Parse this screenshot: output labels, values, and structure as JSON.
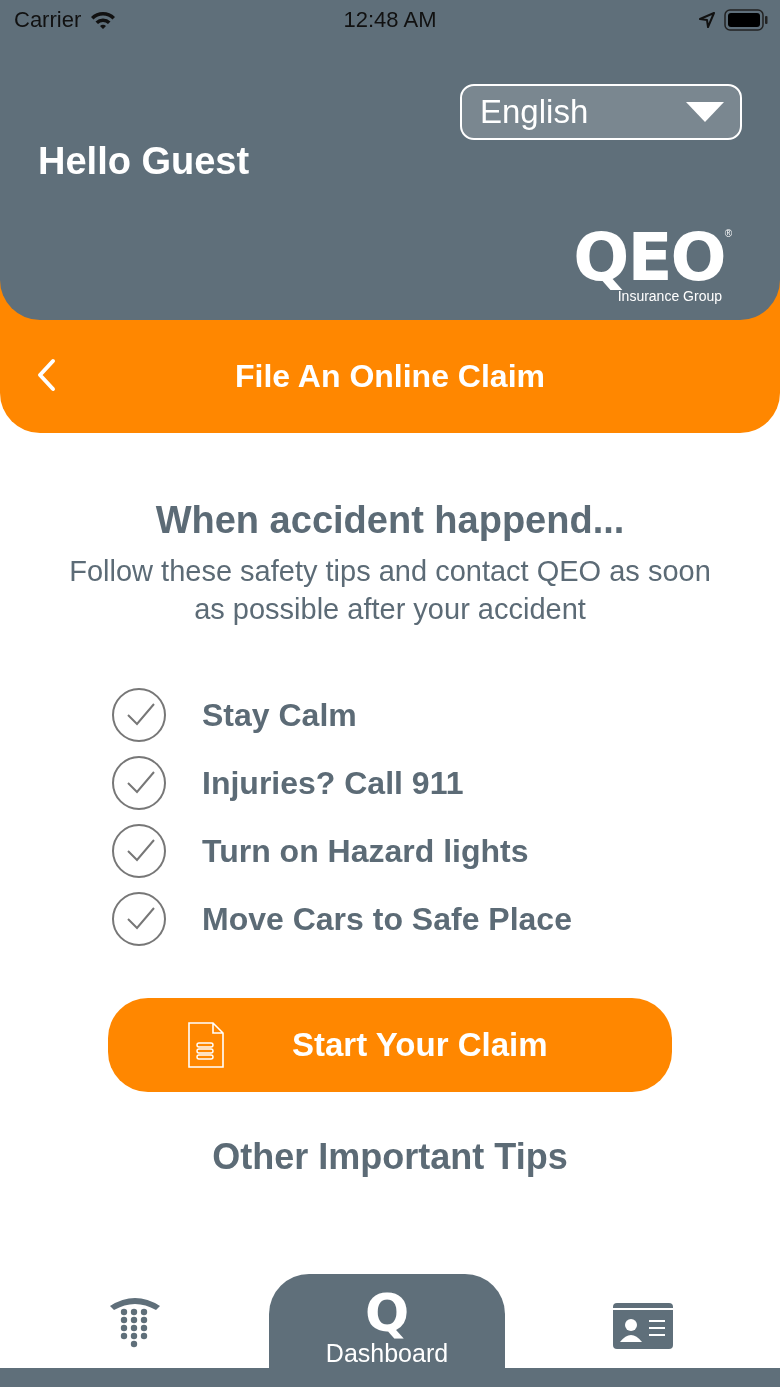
{
  "status_bar": {
    "carrier": "Carrier",
    "time": "12:48 AM"
  },
  "header": {
    "greeting": "Hello Guest",
    "language": {
      "value": "English"
    },
    "logo": {
      "mark": "QEO",
      "registered": "®",
      "tagline": "Insurance Group"
    }
  },
  "nav": {
    "title": "File An Online Claim"
  },
  "intro": {
    "heading": "When accident happend...",
    "text": "Follow these safety tips and contact QEO as soon as possible after your accident"
  },
  "tips": [
    {
      "label": "Stay Calm",
      "checked": true
    },
    {
      "label": "Injuries? Call 911",
      "checked": true
    },
    {
      "label": "Turn on Hazard lights",
      "checked": true
    },
    {
      "label": "Move Cars to Safe Place",
      "checked": true
    }
  ],
  "primary_button": {
    "label": "Start Your Claim"
  },
  "secondary_link": {
    "label": "Other Important Tips"
  },
  "tab_bar": [
    {
      "kind": "phone",
      "selected": false
    },
    {
      "kind": "dashboard",
      "mark": "Q",
      "label": "Dashboard",
      "selected": true
    },
    {
      "kind": "card",
      "selected": false
    }
  ]
}
